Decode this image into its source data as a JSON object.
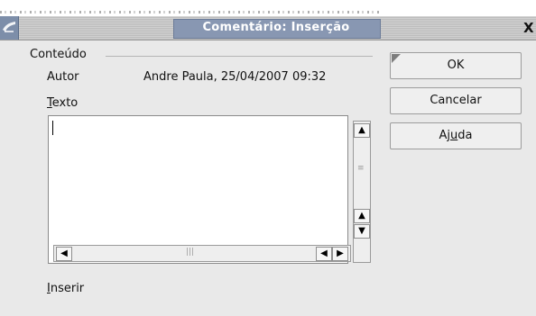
{
  "window": {
    "title": "Comentário: Inserção",
    "close_glyph": "X",
    "app_icon": "office-app-icon"
  },
  "content": {
    "group_label": "Conteúdo",
    "author_label": "Autor",
    "author_value": "Andre Paula, 25/04/2007 09:32",
    "text_label_mnemonic": "T",
    "text_label_rest": "exto",
    "text_value": "",
    "insert_label_mnemonic": "I",
    "insert_label_rest": "nserir"
  },
  "buttons": {
    "ok": "OK",
    "cancel": "Cancelar",
    "help_prefix": "Aj",
    "help_mnemonic": "u",
    "help_suffix": "da"
  },
  "scrollbar_glyphs": {
    "up": "▲",
    "down": "▼",
    "left": "◀",
    "right": "▶"
  }
}
